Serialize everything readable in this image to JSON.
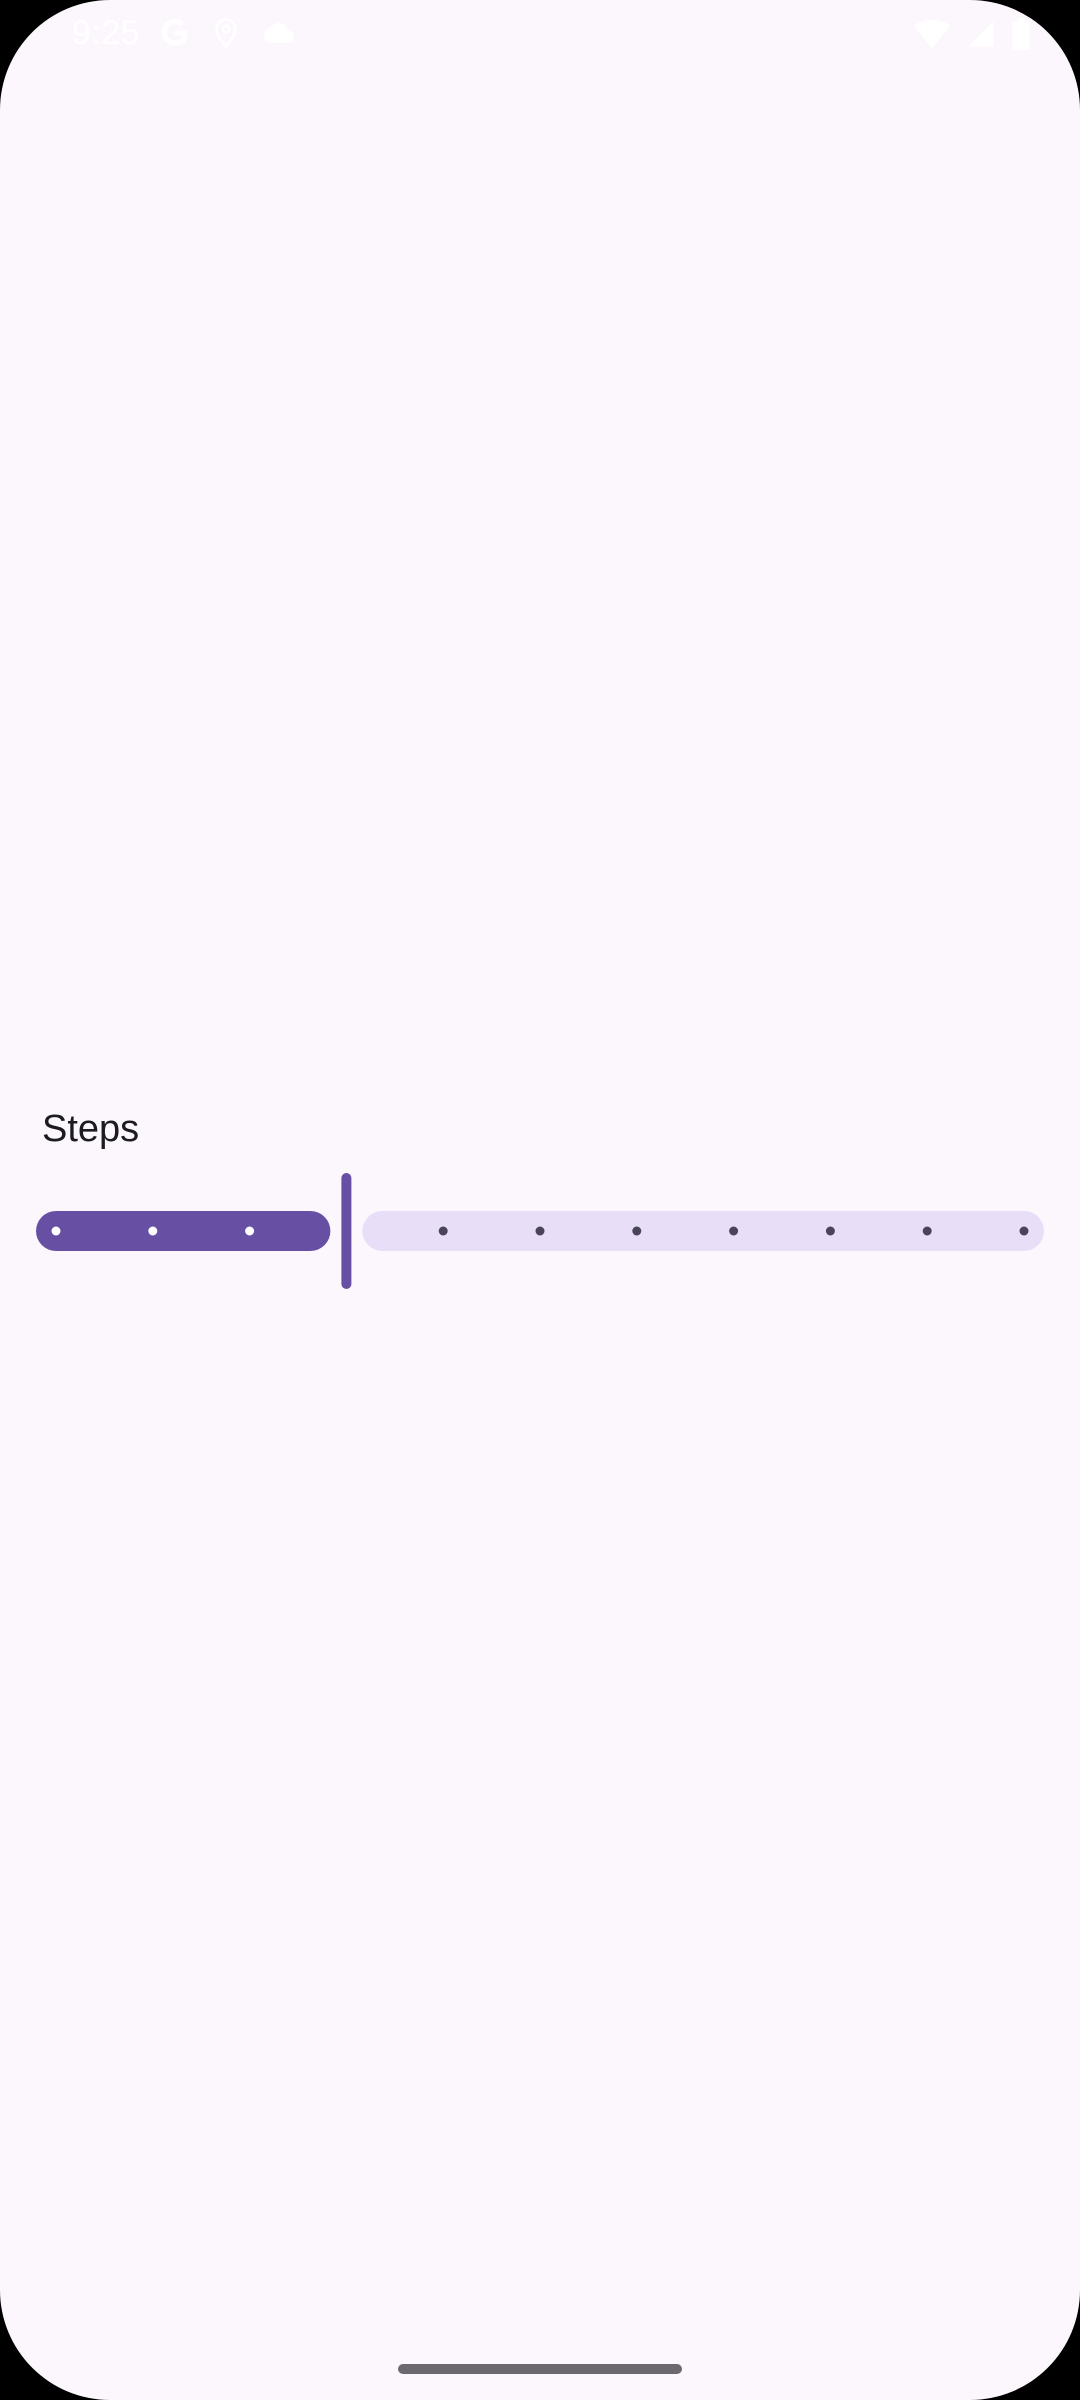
{
  "status_bar": {
    "time": "9:25",
    "icons_left": [
      "google-icon",
      "location-icon",
      "cloud-icon"
    ],
    "icons_right": [
      "wifi-icon",
      "signal-icon",
      "battery-icon"
    ]
  },
  "slider": {
    "label": "Steps",
    "steps": 11,
    "value_fraction": 0.3,
    "colors": {
      "active_track": "#6750A4",
      "inactive_track": "#E8DEF8",
      "active_tick": "#FFFFFF",
      "inactive_tick": "#4A4458",
      "thumb": "#6750A4"
    }
  },
  "colors": {
    "background": "#FCF6FD",
    "text": "#1C1B1F",
    "gesture_bar": "#6B6870"
  }
}
